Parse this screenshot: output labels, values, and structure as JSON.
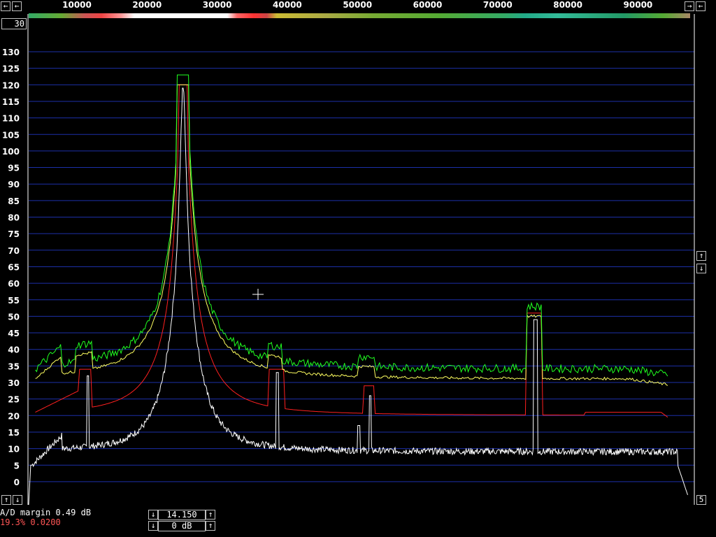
{
  "top_bar": {
    "freq_labels": [
      "10000",
      "20000",
      "30000",
      "40000",
      "50000",
      "60000",
      "70000",
      "80000",
      "90000"
    ],
    "left_arrow_glyph": "←",
    "right_arrow_glyph": "→"
  },
  "averaging_box": {
    "value": "30"
  },
  "y_axis": {
    "labels": [
      "130",
      "125",
      "120",
      "115",
      "110",
      "105",
      "100",
      "95",
      "90",
      "85",
      "80",
      "75",
      "70",
      "65",
      "60",
      "55",
      "50",
      "45",
      "40",
      "35",
      "30",
      "25",
      "20",
      "15",
      "10",
      "5",
      "0"
    ]
  },
  "side_controls": {
    "up_glyph": "↑",
    "down_glyph": "↓",
    "corner_value": "5"
  },
  "status": {
    "ad_margin": "A/D margin 0.49 dB",
    "cpu_load": "19.3% 0.0200"
  },
  "level_controls": {
    "gain_value": "14.150",
    "offset_value": "0 dB"
  },
  "colors": {
    "grid": "#1c2fa8",
    "white_trace": "#ffffff",
    "red_trace": "#ff2020",
    "yellow_trace": "#ffff60",
    "green_trace": "#20ff20"
  }
}
